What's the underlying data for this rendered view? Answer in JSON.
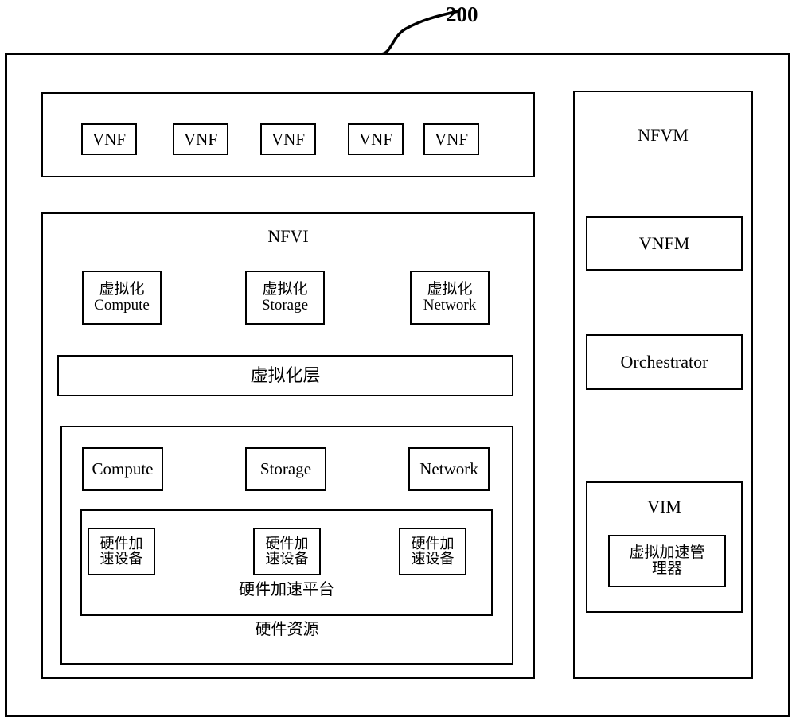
{
  "figure": {
    "reference_number": "200",
    "leader_icon": "curved-leader-line"
  },
  "left_column": {
    "vnf_layer": {
      "items": [
        {
          "label": "VNF"
        },
        {
          "label": "VNF"
        },
        {
          "label": "VNF"
        },
        {
          "label": "VNF"
        },
        {
          "label": "VNF"
        }
      ]
    },
    "nfvi": {
      "title": "NFVI",
      "virtual_resources": [
        {
          "label": "虚拟化\nCompute"
        },
        {
          "label": "虚拟化\nStorage"
        },
        {
          "label": "虚拟化\nNetwork"
        }
      ],
      "virtualization_layer": {
        "label": "虚拟化层"
      },
      "hardware_resources": {
        "label": "硬件资源",
        "items": [
          {
            "label": "Compute"
          },
          {
            "label": "Storage"
          },
          {
            "label": "Network"
          }
        ],
        "acceleration_platform": {
          "label": "硬件加速平台",
          "devices": [
            {
              "label": "硬件加\n速设备"
            },
            {
              "label": "硬件加\n速设备"
            },
            {
              "label": "硬件加\n速设备"
            }
          ]
        }
      }
    }
  },
  "right_column": {
    "title": "NFVM",
    "vnfm": {
      "label": "VNFM"
    },
    "orchestrator": {
      "label": "Orchestrator"
    },
    "vim": {
      "title": "VIM",
      "virtual_acceleration_manager": {
        "label": "虚拟加速管\n理器"
      }
    }
  },
  "colors": {
    "stroke": "#000000",
    "background": "#ffffff",
    "text": "#000000"
  }
}
